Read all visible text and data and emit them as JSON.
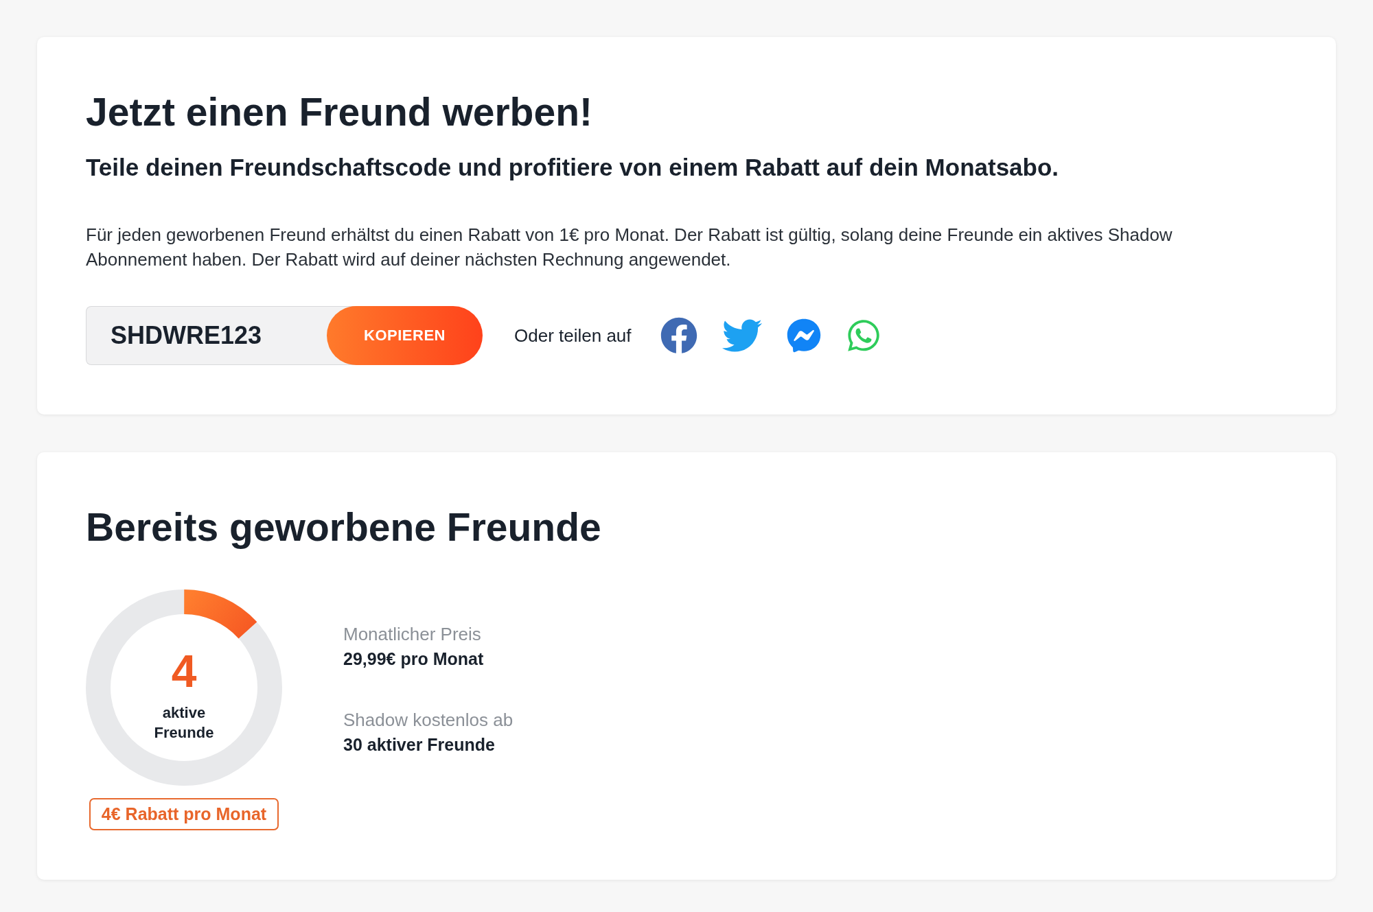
{
  "referral_card": {
    "title": "Jetzt einen Freund werben!",
    "subtitle": "Teile deinen Freundschaftscode und profitiere von einem Rabatt auf dein Monatsabo.",
    "description": "Für jeden geworbenen Freund erhältst du einen Rabatt von 1€ pro Monat. Der Rabatt ist gültig, solang deine Freunde ein aktives Shadow Abonnement haben. Der Rabatt wird auf deiner nächsten Rechnung angewendet.",
    "code_field": {
      "value": "SHDWRE123"
    },
    "copy_button": "KOPIEREN",
    "share_label": "Oder teilen auf"
  },
  "friends_card": {
    "title": "Bereits geworbene Freunde",
    "progress_ring": {
      "count": "4",
      "label": "aktive Freunde",
      "level": 0.133
    },
    "discount_badge": "4€ Rabatt pro Monat",
    "stats": [
      {
        "label": "Monatlicher Preis",
        "value": "29,99€ pro Monat"
      },
      {
        "label": "Shadow kostenlos ab",
        "value": "30 aktiver Freunde"
      }
    ]
  }
}
